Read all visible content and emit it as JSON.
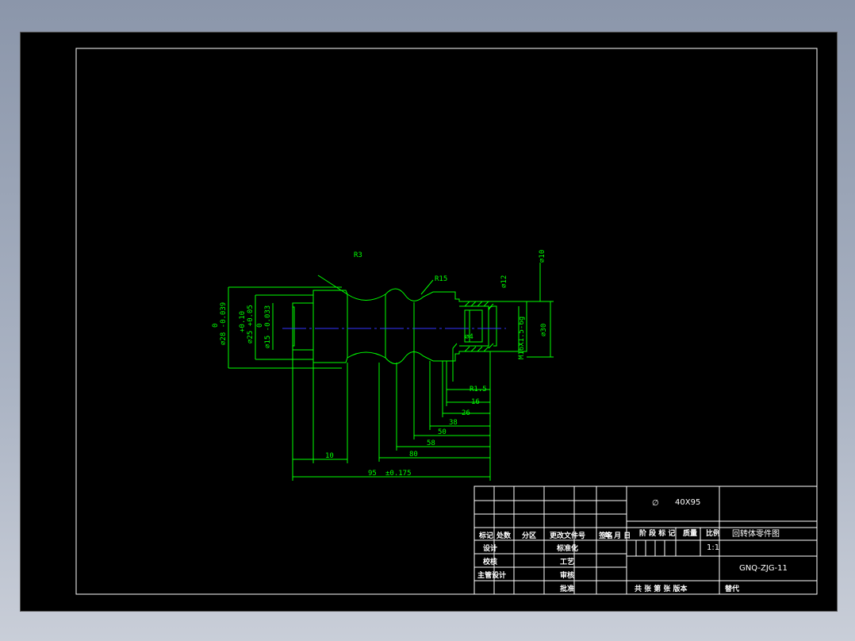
{
  "drawing": {
    "dimensions": {
      "r3": "R3",
      "r15": "R15",
      "d12": "∅12",
      "d10": "∅10",
      "d30": "∅30",
      "d28": "∅28 -0.039",
      "d28_upper": "0",
      "d25": "∅25 +0.05",
      "d25_upper": "+0.10",
      "d15": "∅15 -0.033",
      "d15_upper": "0",
      "thread": "M16X1.5-6g",
      "d4": "∅4",
      "r1_5": "R1.5",
      "len16": "16",
      "len26": "26",
      "len38": "38",
      "len50": "50",
      "len58": "58",
      "len80": "80",
      "len10": "10",
      "len95": "95",
      "tol95": "±0.175"
    }
  },
  "title_block": {
    "material_symbol": "∅",
    "material": "40X95",
    "headers": {
      "mark": "标记",
      "count": "处数",
      "zone": "分区",
      "doc_no": "更改文件号",
      "sign": "签名",
      "date": "年 月 日",
      "stage_mark": "阶 段 标 记",
      "weight": "质量",
      "scale": "比例"
    },
    "scale_value": "1:1",
    "rows": {
      "design": "设计",
      "check": "校核",
      "chief": "主管设计",
      "standard": "标准化",
      "process": "工艺",
      "review": "审核",
      "approve": "批准"
    },
    "drawing_title": "回转体零件图",
    "drawing_number": "GNQ-ZJG-11",
    "sheets": "共 张 第 张 版本",
    "replace": "替代"
  },
  "colors": {
    "background": "#000000",
    "geometry": "#00ff00",
    "centerline": "#3333ff",
    "frame": "#ffffff"
  }
}
